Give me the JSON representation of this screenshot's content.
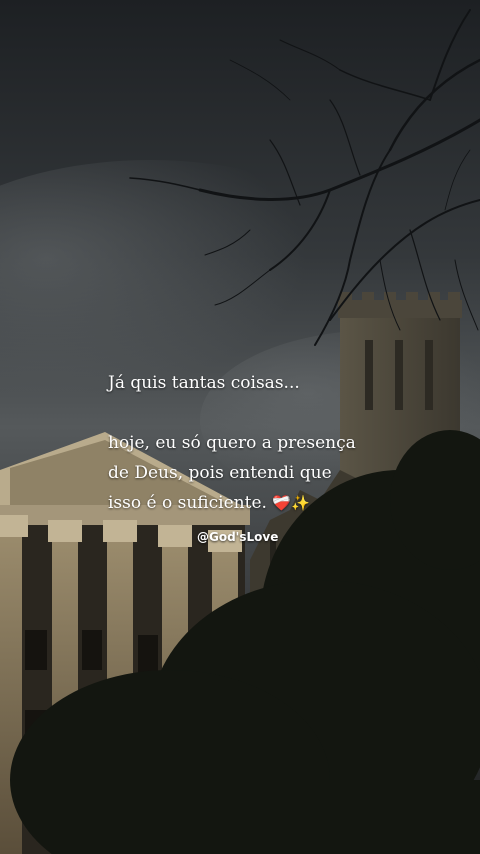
{
  "quote": {
    "line1": "Já quis tantas coisas...",
    "line2": "hoje, eu só quero a presença",
    "line3": "de Deus, pois entendi que",
    "line4": "isso é o suficiente.",
    "emoji_heart": "❤️‍🩹",
    "emoji_sparkles": "✨"
  },
  "watermark": {
    "handle": "@God'sLove"
  },
  "colors": {
    "sky_dark": "#22262a",
    "sky_mid": "#4a4e50",
    "building": "#8a7a5e",
    "foliage": "#14180f",
    "text": "#ffffff"
  }
}
